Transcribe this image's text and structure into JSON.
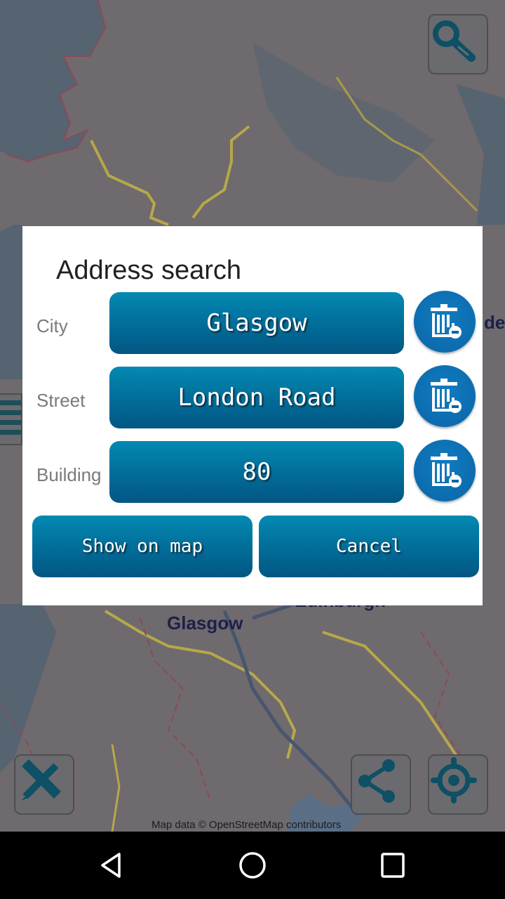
{
  "map": {
    "labels": {
      "glasgow": "Glasgow",
      "edinburgh": "Edinburgh",
      "partial_right": "de"
    },
    "attribution": "Map data © OpenStreetMap contributors",
    "buttons": {
      "search": "search-icon",
      "measure": "ruler-pencil-icon",
      "share": "share-icon",
      "locate": "locate-icon"
    }
  },
  "dialog": {
    "title": "Address search",
    "rows": [
      {
        "label": "City",
        "value": "Glasgow"
      },
      {
        "label": "Street",
        "value": "London Road"
      },
      {
        "label": "Building",
        "value": "80"
      }
    ],
    "clear_icon": "trash-clear-icon",
    "show_on_map_label": "Show on map",
    "cancel_label": "Cancel"
  },
  "navbar": {
    "back": "back-icon",
    "home": "home-icon",
    "recents": "recents-icon"
  },
  "colors": {
    "button_top": "#0389b2",
    "button_bottom": "#035683",
    "clear_button": "#0a66a8",
    "map_dim": "#6f6a6d"
  }
}
